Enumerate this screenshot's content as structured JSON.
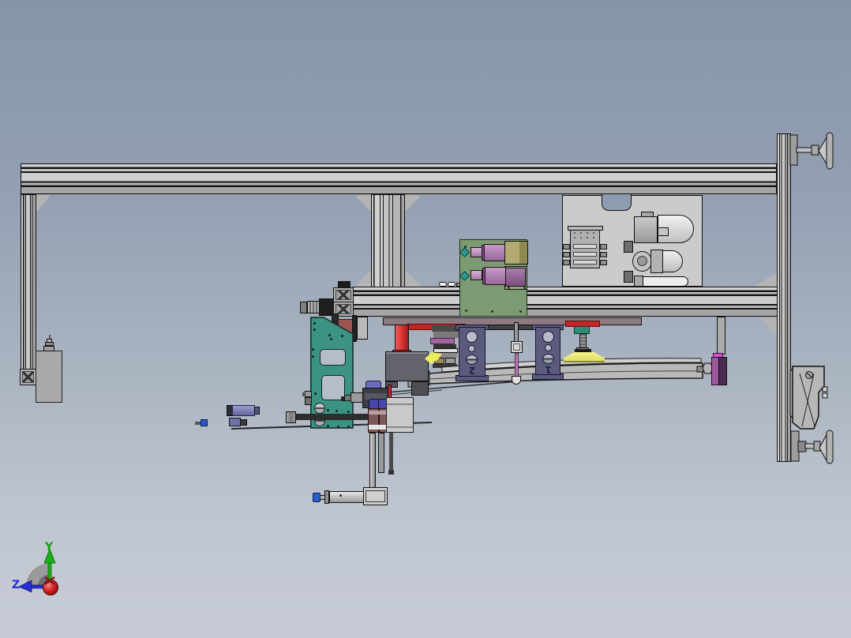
{
  "scene": {
    "description": "3D CAD assembly side view of a pick-and-place gantry machine",
    "background_top": "#8695aa",
    "background_bottom": "#c5cad3"
  },
  "orientation_triad": {
    "y_axis_label": "Y",
    "z_axis_label": "Z",
    "y_axis_color": "#15a015",
    "z_axis_color": "#2531d6",
    "origin_color": "#c41414"
  },
  "part_labels": {
    "station_2": "2",
    "station_1": "1",
    "label_color": "#20203d"
  },
  "key_colors": {
    "aluminum_frame": "#bdbdbd",
    "back_panel": "#cbcbcb",
    "sensor_plate_green": "#7d9b72",
    "camera_barrel_purple": "#a574a5",
    "camera_block_khaki": "#b2aa70",
    "indicator_teal": "#2a9a9a",
    "bracket_plate_slate": "#5b5b7e",
    "support_column_red": "#d63232",
    "suction_cup_yellow": "#ededa0",
    "rail_end_magenta": "#d44fd4",
    "mount_plate_teal": "#3d9383",
    "clamp_block_maroon": "#9a554e",
    "cylinder_cap_blue": "#2b5fd0",
    "carriage_plate_mauve": "#8d7a80"
  }
}
